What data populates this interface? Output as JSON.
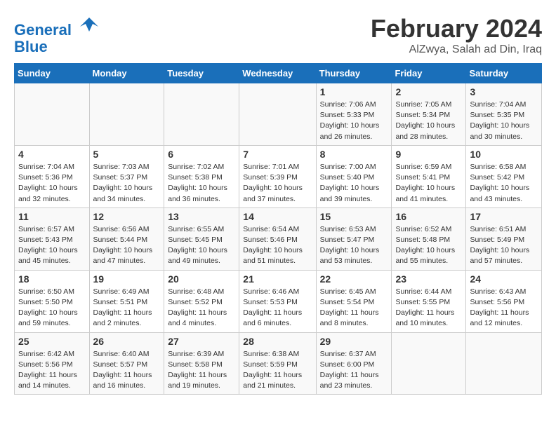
{
  "header": {
    "logo_line1": "General",
    "logo_line2": "Blue",
    "month": "February 2024",
    "location": "AlZwya, Salah ad Din, Iraq"
  },
  "days_of_week": [
    "Sunday",
    "Monday",
    "Tuesday",
    "Wednesday",
    "Thursday",
    "Friday",
    "Saturday"
  ],
  "weeks": [
    [
      {
        "day": "",
        "info": ""
      },
      {
        "day": "",
        "info": ""
      },
      {
        "day": "",
        "info": ""
      },
      {
        "day": "",
        "info": ""
      },
      {
        "day": "1",
        "info": "Sunrise: 7:06 AM\nSunset: 5:33 PM\nDaylight: 10 hours and 26 minutes."
      },
      {
        "day": "2",
        "info": "Sunrise: 7:05 AM\nSunset: 5:34 PM\nDaylight: 10 hours and 28 minutes."
      },
      {
        "day": "3",
        "info": "Sunrise: 7:04 AM\nSunset: 5:35 PM\nDaylight: 10 hours and 30 minutes."
      }
    ],
    [
      {
        "day": "4",
        "info": "Sunrise: 7:04 AM\nSunset: 5:36 PM\nDaylight: 10 hours and 32 minutes."
      },
      {
        "day": "5",
        "info": "Sunrise: 7:03 AM\nSunset: 5:37 PM\nDaylight: 10 hours and 34 minutes."
      },
      {
        "day": "6",
        "info": "Sunrise: 7:02 AM\nSunset: 5:38 PM\nDaylight: 10 hours and 36 minutes."
      },
      {
        "day": "7",
        "info": "Sunrise: 7:01 AM\nSunset: 5:39 PM\nDaylight: 10 hours and 37 minutes."
      },
      {
        "day": "8",
        "info": "Sunrise: 7:00 AM\nSunset: 5:40 PM\nDaylight: 10 hours and 39 minutes."
      },
      {
        "day": "9",
        "info": "Sunrise: 6:59 AM\nSunset: 5:41 PM\nDaylight: 10 hours and 41 minutes."
      },
      {
        "day": "10",
        "info": "Sunrise: 6:58 AM\nSunset: 5:42 PM\nDaylight: 10 hours and 43 minutes."
      }
    ],
    [
      {
        "day": "11",
        "info": "Sunrise: 6:57 AM\nSunset: 5:43 PM\nDaylight: 10 hours and 45 minutes."
      },
      {
        "day": "12",
        "info": "Sunrise: 6:56 AM\nSunset: 5:44 PM\nDaylight: 10 hours and 47 minutes."
      },
      {
        "day": "13",
        "info": "Sunrise: 6:55 AM\nSunset: 5:45 PM\nDaylight: 10 hours and 49 minutes."
      },
      {
        "day": "14",
        "info": "Sunrise: 6:54 AM\nSunset: 5:46 PM\nDaylight: 10 hours and 51 minutes."
      },
      {
        "day": "15",
        "info": "Sunrise: 6:53 AM\nSunset: 5:47 PM\nDaylight: 10 hours and 53 minutes."
      },
      {
        "day": "16",
        "info": "Sunrise: 6:52 AM\nSunset: 5:48 PM\nDaylight: 10 hours and 55 minutes."
      },
      {
        "day": "17",
        "info": "Sunrise: 6:51 AM\nSunset: 5:49 PM\nDaylight: 10 hours and 57 minutes."
      }
    ],
    [
      {
        "day": "18",
        "info": "Sunrise: 6:50 AM\nSunset: 5:50 PM\nDaylight: 10 hours and 59 minutes."
      },
      {
        "day": "19",
        "info": "Sunrise: 6:49 AM\nSunset: 5:51 PM\nDaylight: 11 hours and 2 minutes."
      },
      {
        "day": "20",
        "info": "Sunrise: 6:48 AM\nSunset: 5:52 PM\nDaylight: 11 hours and 4 minutes."
      },
      {
        "day": "21",
        "info": "Sunrise: 6:46 AM\nSunset: 5:53 PM\nDaylight: 11 hours and 6 minutes."
      },
      {
        "day": "22",
        "info": "Sunrise: 6:45 AM\nSunset: 5:54 PM\nDaylight: 11 hours and 8 minutes."
      },
      {
        "day": "23",
        "info": "Sunrise: 6:44 AM\nSunset: 5:55 PM\nDaylight: 11 hours and 10 minutes."
      },
      {
        "day": "24",
        "info": "Sunrise: 6:43 AM\nSunset: 5:56 PM\nDaylight: 11 hours and 12 minutes."
      }
    ],
    [
      {
        "day": "25",
        "info": "Sunrise: 6:42 AM\nSunset: 5:56 PM\nDaylight: 11 hours and 14 minutes."
      },
      {
        "day": "26",
        "info": "Sunrise: 6:40 AM\nSunset: 5:57 PM\nDaylight: 11 hours and 16 minutes."
      },
      {
        "day": "27",
        "info": "Sunrise: 6:39 AM\nSunset: 5:58 PM\nDaylight: 11 hours and 19 minutes."
      },
      {
        "day": "28",
        "info": "Sunrise: 6:38 AM\nSunset: 5:59 PM\nDaylight: 11 hours and 21 minutes."
      },
      {
        "day": "29",
        "info": "Sunrise: 6:37 AM\nSunset: 6:00 PM\nDaylight: 11 hours and 23 minutes."
      },
      {
        "day": "",
        "info": ""
      },
      {
        "day": "",
        "info": ""
      }
    ]
  ]
}
